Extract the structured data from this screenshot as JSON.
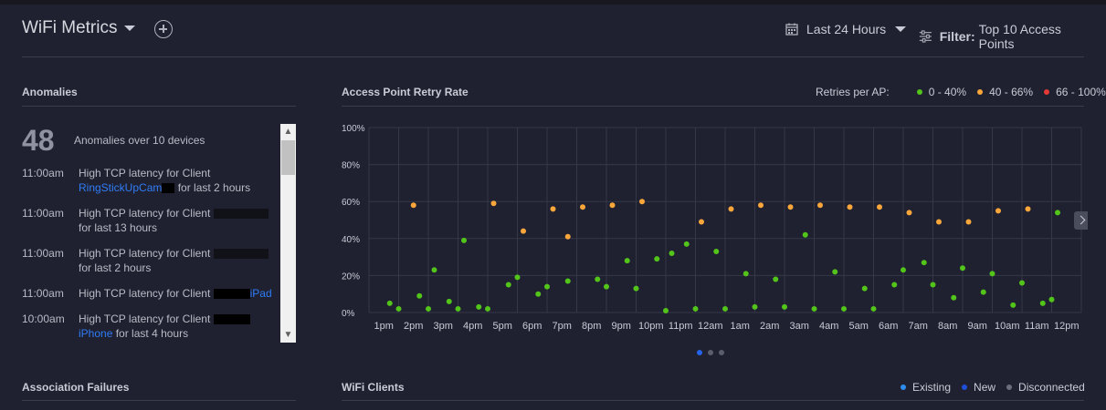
{
  "header": {
    "title": "WiFi Metrics",
    "time_range": "Last 24 Hours",
    "filter_label": "Filter:",
    "filter_value": "Top 10 Access Points"
  },
  "anomalies": {
    "section_title": "Anomalies",
    "count": "48",
    "summary": "Anomalies over 10 devices",
    "items": [
      {
        "time": "11:00am",
        "prefix": "High TCP latency for Client",
        "client": "RingStickUpCam",
        "suffix": "for last 2 hours"
      },
      {
        "time": "11:00am",
        "prefix": "High TCP latency for Client",
        "client": "",
        "suffix": "for last 13 hours"
      },
      {
        "time": "11:00am",
        "prefix": "High TCP latency for Client",
        "client": "",
        "suffix": "for last 2 hours"
      },
      {
        "time": "11:00am",
        "prefix": "High TCP latency for Client",
        "client": "iPad",
        "suffix": ""
      },
      {
        "time": "10:00am",
        "prefix": "High TCP latency for Client",
        "client": "iPhone",
        "suffix": "for last 4 hours"
      }
    ]
  },
  "retry_chart": {
    "section_title": "Access Point Retry Rate",
    "legend_label": "Retries per AP:",
    "legend": [
      {
        "label": "0 - 40%",
        "color": "#52c41a"
      },
      {
        "label": "40 - 66%",
        "color": "#faa63a"
      },
      {
        "label": "66 - 100%",
        "color": "#e53935"
      }
    ]
  },
  "chart_data": {
    "type": "scatter",
    "title": "Access Point Retry Rate",
    "categories": [
      "1pm",
      "2pm",
      "3pm",
      "4pm",
      "5pm",
      "6pm",
      "7pm",
      "8pm",
      "9pm",
      "10pm",
      "11pm",
      "12am",
      "1am",
      "2am",
      "3am",
      "4am",
      "5am",
      "6am",
      "7am",
      "8am",
      "9am",
      "10am",
      "11am",
      "12pm"
    ],
    "y_ticks": [
      "0%",
      "20%",
      "40%",
      "60%",
      "80%",
      "100%"
    ],
    "ylim": [
      0,
      100
    ],
    "series": [
      {
        "name": "0 - 40%",
        "color": "#52c41a",
        "points": [
          [
            0.7,
            5
          ],
          [
            1,
            2
          ],
          [
            1.7,
            9
          ],
          [
            2,
            2
          ],
          [
            2.2,
            23
          ],
          [
            2.7,
            6
          ],
          [
            3,
            2
          ],
          [
            3.2,
            39
          ],
          [
            3.7,
            3
          ],
          [
            4,
            2
          ],
          [
            4.7,
            15
          ],
          [
            5,
            19
          ],
          [
            5.7,
            10
          ],
          [
            6,
            14
          ],
          [
            6.7,
            17
          ],
          [
            7.7,
            18
          ],
          [
            8,
            14
          ],
          [
            8.7,
            28
          ],
          [
            9,
            13
          ],
          [
            9.7,
            29
          ],
          [
            10,
            1
          ],
          [
            10.2,
            32
          ],
          [
            10.7,
            37
          ],
          [
            11,
            2
          ],
          [
            11.7,
            33
          ],
          [
            12,
            2
          ],
          [
            12.7,
            21
          ],
          [
            13,
            3
          ],
          [
            13.7,
            18
          ],
          [
            14,
            3
          ],
          [
            14.7,
            42
          ],
          [
            15,
            2
          ],
          [
            15.7,
            22
          ],
          [
            16,
            2
          ],
          [
            16.7,
            13
          ],
          [
            17,
            2
          ],
          [
            17.7,
            15
          ],
          [
            18,
            23
          ],
          [
            18.7,
            27
          ],
          [
            19,
            15
          ],
          [
            19.7,
            8
          ],
          [
            20,
            24
          ],
          [
            20.7,
            11
          ],
          [
            21,
            21
          ],
          [
            21.7,
            4
          ],
          [
            22,
            16
          ],
          [
            22.7,
            5
          ],
          [
            23,
            7
          ],
          [
            23.2,
            54
          ]
        ]
      },
      {
        "name": "40 - 66%",
        "color": "#faa63a",
        "points": [
          [
            1.5,
            58
          ],
          [
            4.2,
            59
          ],
          [
            5.2,
            44
          ],
          [
            6.2,
            56
          ],
          [
            6.7,
            41
          ],
          [
            7.2,
            57
          ],
          [
            8.2,
            58
          ],
          [
            9.2,
            60
          ],
          [
            11.2,
            49
          ],
          [
            12.2,
            56
          ],
          [
            13.2,
            58
          ],
          [
            14.2,
            57
          ],
          [
            15.2,
            58
          ],
          [
            16.2,
            57
          ],
          [
            17.2,
            57
          ],
          [
            18.2,
            54
          ],
          [
            19.2,
            49
          ],
          [
            20.2,
            49
          ],
          [
            21.2,
            55
          ],
          [
            22.2,
            56
          ]
        ]
      },
      {
        "name": "66 - 100%",
        "color": "#e53935",
        "points": []
      }
    ]
  },
  "pagination": {
    "pages": 3,
    "current": 1
  },
  "association": {
    "section_title": "Association Failures"
  },
  "clients": {
    "section_title": "WiFi Clients",
    "legend": [
      {
        "label": "Existing",
        "color": "#2f8cf0"
      },
      {
        "label": "New",
        "color": "#1f4fd8"
      },
      {
        "label": "Disconnected",
        "color": "#6b6e7c"
      }
    ]
  }
}
